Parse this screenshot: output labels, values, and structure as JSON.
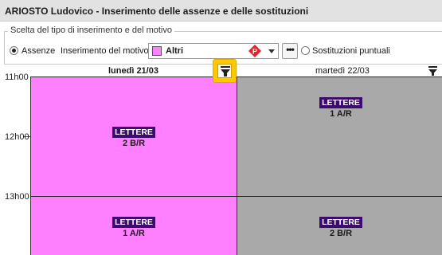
{
  "window": {
    "title": "ARIOSTO Ludovico - Inserimento delle assenze e delle sostituzioni"
  },
  "group": {
    "legend": "Scelta del tipo di inserimento e del motivo"
  },
  "options": {
    "absences_label": "Assenze",
    "absences_selected": true,
    "reason_label": "Inserimento del motivo",
    "reason_value": "Altri",
    "reason_color": "#ff80ff",
    "reason_badge_letter": "P",
    "more_label": "•••",
    "substitutions_label": "Sostituzioni puntuali",
    "substitutions_selected": false
  },
  "calendar": {
    "hours": [
      "11h00",
      "12h00",
      "13h00"
    ],
    "days": [
      {
        "label": "lunedì 21/03",
        "highlighted": true,
        "color": "#ff80ff"
      },
      {
        "label": "martedì 22/03",
        "highlighted": false,
        "color": "#a9a9a9"
      }
    ],
    "lessons": [
      {
        "subject": "LETTERE",
        "class": "2 B/R"
      },
      {
        "subject": "LETTERE",
        "class": "1 A/R"
      },
      {
        "subject": "LETTERE",
        "class": "1 A/R"
      },
      {
        "subject": "LETTERE",
        "class": "2 B/R"
      }
    ]
  },
  "colors": {
    "accent_yellow": "#ffc800",
    "subject_badge": "#3d0a6e",
    "badge_red": "#e8202a"
  },
  "icons": {
    "collapse": "download-arrow-icon",
    "column_menu": "download-arrow-icon",
    "reason_badge": "p-diamond-icon",
    "dropdown": "chevron-down-icon"
  }
}
